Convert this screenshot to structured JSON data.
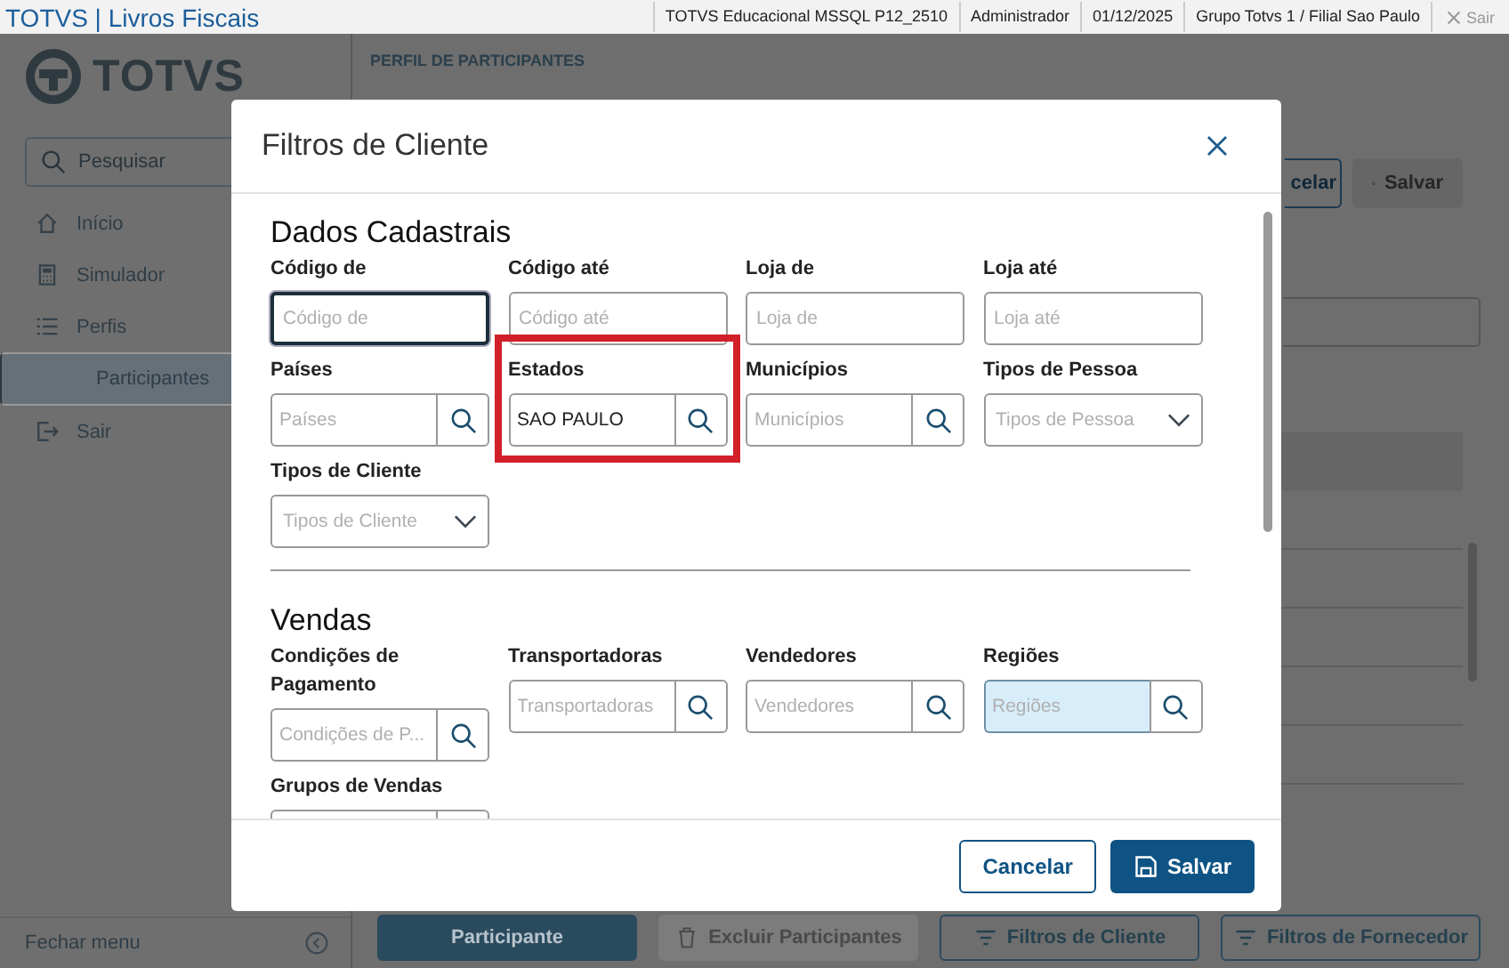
{
  "top_bar": {
    "title": "TOTVS | Livros Fiscais",
    "info": [
      "TOTVS Educacional MSSQL P12_2510",
      "Administrador",
      "01/12/2025",
      "Grupo Totvs 1 / Filial Sao Paulo"
    ],
    "exit": {
      "label": "Sair",
      "disabled": true
    }
  },
  "sidebar": {
    "logo": "TOTVS",
    "search": {
      "placeholder": "Pesquisar"
    },
    "items": [
      {
        "label": "Início",
        "kind": "home",
        "selected": false
      },
      {
        "label": "Simulador",
        "kind": "calculator",
        "selected": false
      },
      {
        "label": "Perfis",
        "kind": "list",
        "selected": false,
        "children": [
          {
            "label": "Participantes",
            "selected": true
          }
        ]
      },
      {
        "label": "Sair",
        "kind": "exit",
        "selected": false
      }
    ],
    "collapse": {
      "label": "Fechar menu"
    }
  },
  "page": {
    "title": "PERFIL DE PARTICIPANTES",
    "top_buttons": [
      {
        "label": "celar",
        "kind": "outline",
        "disabled": false
      },
      {
        "label": "Salvar",
        "kind": "primary",
        "disabled": true
      }
    ],
    "bottom_buttons": [
      {
        "label": "Participante",
        "kind": "primary",
        "disabled": false
      },
      {
        "label": "Excluir Participantes",
        "kind": "delete",
        "disabled": true
      },
      {
        "label": "Filtros de Cliente",
        "kind": "filter",
        "disabled": false
      },
      {
        "label": "Filtros de Fornecedor",
        "kind": "filter",
        "disabled": false
      }
    ]
  },
  "dialog": {
    "title": "Filtros de Cliente",
    "sections": [
      {
        "title": "Dados Cadastrais",
        "fields": [
          {
            "label": "Código de",
            "kind": "text",
            "placeholder": "Código de",
            "focused": true,
            "highlighted": false,
            "annotated": false
          },
          {
            "label": "Código até",
            "kind": "text",
            "placeholder": "Código até",
            "focused": false,
            "highlighted": false,
            "annotated": false
          },
          {
            "label": "Loja de",
            "kind": "text",
            "placeholder": "Loja de",
            "focused": false,
            "highlighted": false,
            "annotated": false
          },
          {
            "label": "Loja até",
            "kind": "text",
            "placeholder": "Loja até",
            "focused": false,
            "highlighted": false,
            "annotated": false
          },
          {
            "label": "Países",
            "kind": "lookup",
            "placeholder": "Países",
            "focused": false,
            "highlighted": false,
            "annotated": false
          },
          {
            "label": "Estados",
            "kind": "lookup",
            "value": "SAO PAULO",
            "focused": false,
            "highlighted": false,
            "annotated": true
          },
          {
            "label": "Municípios",
            "kind": "lookup",
            "placeholder": "Municípios",
            "focused": false,
            "highlighted": false,
            "annotated": false
          },
          {
            "label": "Tipos de Pessoa",
            "kind": "select",
            "placeholder": "Tipos de Pessoa",
            "focused": false,
            "highlighted": false,
            "annotated": false
          },
          {
            "label": "Tipos de Cliente",
            "kind": "select",
            "placeholder": "Tipos de Cliente",
            "focused": false,
            "highlighted": false,
            "annotated": false
          }
        ]
      },
      {
        "title": "Vendas",
        "fields": [
          {
            "label": "Condições de Pagamento",
            "kind": "lookup",
            "placeholder": "Condições de P...",
            "focused": false,
            "highlighted": false,
            "annotated": false
          },
          {
            "label": "Transportadoras",
            "kind": "lookup",
            "placeholder": "Transportadoras",
            "focused": false,
            "highlighted": false,
            "annotated": false
          },
          {
            "label": "Vendedores",
            "kind": "lookup",
            "placeholder": "Vendedores",
            "focused": false,
            "highlighted": false,
            "annotated": false
          },
          {
            "label": "Regiões",
            "kind": "lookup",
            "placeholder": "Regiões",
            "focused": false,
            "highlighted": true,
            "annotated": false
          },
          {
            "label": "Grupos de Vendas",
            "kind": "lookup",
            "focused": false,
            "highlighted": false,
            "annotated": false
          }
        ]
      }
    ],
    "buttons": [
      {
        "label": "Cancelar",
        "kind": "secondary"
      },
      {
        "label": "Salvar",
        "kind": "primary"
      }
    ]
  }
}
